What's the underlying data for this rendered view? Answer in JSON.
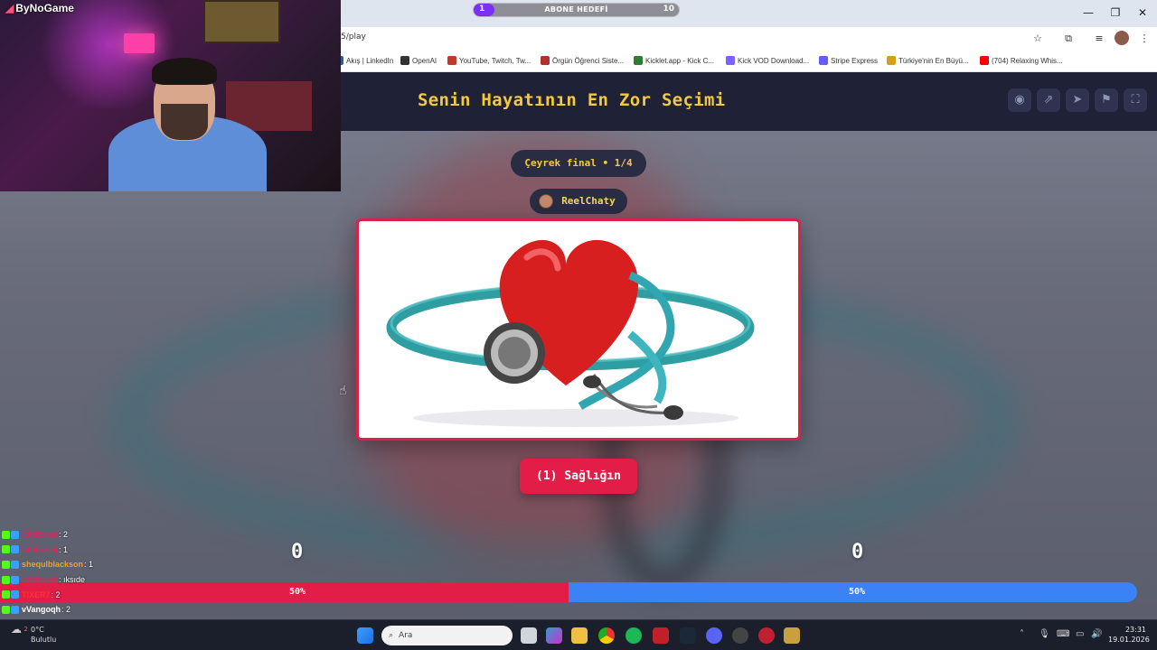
{
  "browser": {
    "url": "5/play",
    "goal": {
      "count": "1",
      "label": "ABONE HEDEFİ",
      "target": "10",
      "progress": 0.1
    },
    "bookmarks": [
      {
        "label": "Akış | LinkedIn",
        "color": "#0a66c2"
      },
      {
        "label": "OpenAI",
        "color": "#333333"
      },
      {
        "label": "YouTube, Twitch, Tw...",
        "color": "#c0392b"
      },
      {
        "label": "Örgün Öğrenci Siste...",
        "color": "#b03030"
      },
      {
        "label": "Kicklet.app - Kick C...",
        "color": "#2e7d32"
      },
      {
        "label": "Kick VOD Download...",
        "color": "#7b61ff"
      },
      {
        "label": "Stripe Express",
        "color": "#635bff"
      },
      {
        "label": "Türkiye'nin En Büyü...",
        "color": "#d4a017"
      },
      {
        "label": "(704) Relaxing Whis...",
        "color": "#ff0000"
      }
    ],
    "window_controls": {
      "minimize": "—",
      "maximize": "❐",
      "close": "✕"
    }
  },
  "game": {
    "title": "Senin Hayatının En Zor Seçimi",
    "round": "Çeyrek final • 1/4",
    "user": "ReelChaty",
    "choice_label": "(1) Sağlığın",
    "score_left": "0",
    "score_right": "0",
    "percent_left": "50%",
    "percent_right": "50%",
    "vote_share_left": 0.5,
    "colors": {
      "left": "#e11d48",
      "right": "#3b82f6",
      "title": "#f5c93b",
      "header": "#1f2137"
    },
    "header_icons": [
      "eye-icon",
      "share-icon",
      "send-icon",
      "flag-icon",
      "fullscreen-icon"
    ]
  },
  "stream": {
    "logo": "ByNoGame"
  },
  "chat": [
    {
      "name": "lchliturek",
      "msg": ": 2",
      "color": "#e0245e"
    },
    {
      "name": "lchliturek",
      "msg": ": 1",
      "color": "#e0245e"
    },
    {
      "name": "shequlblackson",
      "msg": ": 1",
      "color": "#f0a020"
    },
    {
      "name": "lchliturek",
      "msg": ": ıksıde",
      "color": "#e0245e"
    },
    {
      "name": "TIXER7",
      "msg": ": 2",
      "color": "#ff3030"
    },
    {
      "name": "vVangoqh",
      "msg": ": 2",
      "color": "#ffffff"
    }
  ],
  "taskbar": {
    "weather_temp": "0°C",
    "weather_desc": "Bulutlu",
    "weather_badge": "2",
    "search_placeholder": "Ara",
    "time": "23:31",
    "date": "19.01.2026"
  }
}
